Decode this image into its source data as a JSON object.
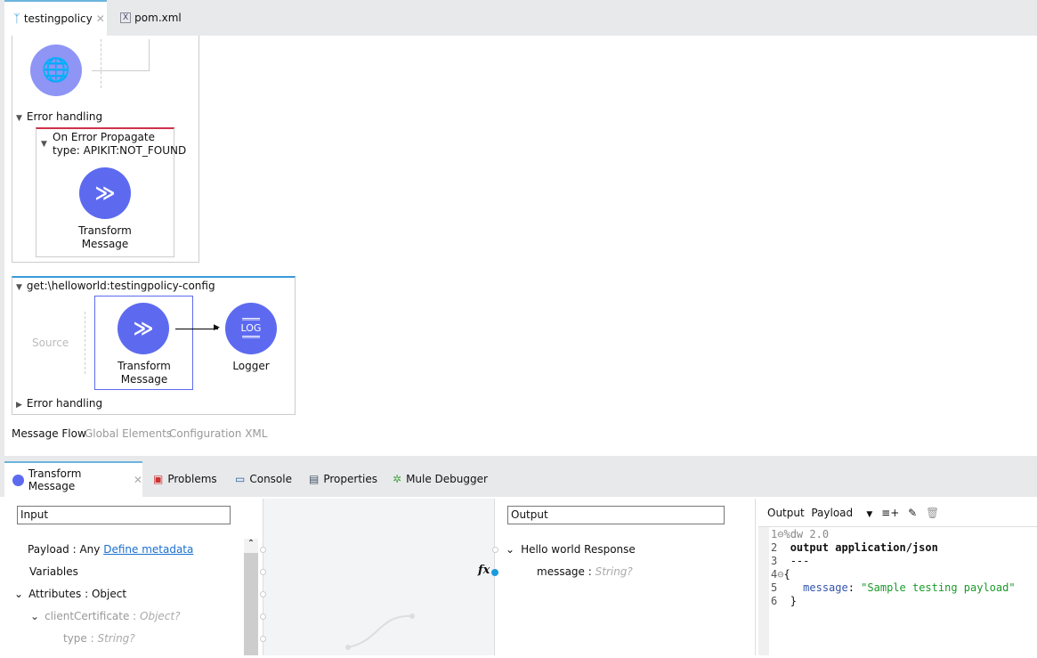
{
  "editor_tabs": [
    {
      "label": "testingpolicy",
      "icon": "mule-icon"
    },
    {
      "label": "pom.xml",
      "icon": "xml-file-icon"
    }
  ],
  "flow1": {
    "error_handling": "Error handling",
    "on_error_title": "On Error Propagate",
    "on_error_type": "type: APIKIT:NOT_FOUND",
    "transform": "Transform Message"
  },
  "flow2": {
    "name": "get:\\helloworld:testingpolicy-config",
    "source": "Source",
    "transform": "Transform Message",
    "logger": "Logger",
    "logger_glyph": "LOG",
    "error_handling": "Error handling"
  },
  "canvas_tabs": [
    "Message Flow",
    "Global Elements",
    "Configuration XML"
  ],
  "bottom_tabs": [
    "Transform Message",
    "Problems",
    "Console",
    "Properties",
    "Mule Debugger"
  ],
  "input": {
    "placeholder": "Input",
    "payload": "Payload : Any",
    "define_metadata": "Define metadata",
    "variables": "Variables",
    "attributes": "Attributes : Object",
    "client_cert": "clientCertificate : ",
    "client_cert_type": "Object?",
    "type": "type : ",
    "type_type": "String?"
  },
  "output": {
    "placeholder": "Output",
    "root": "Hello world Response",
    "field": "message : ",
    "field_type": "String?",
    "fx": "fx"
  },
  "editor": {
    "output_label": "Output",
    "target": "Payload",
    "lines": [
      {
        "n": "1",
        "t": "%dw 2.0"
      },
      {
        "n": "2",
        "t": "output application/json"
      },
      {
        "n": "3",
        "t": "---"
      },
      {
        "n": "4",
        "t": "{"
      },
      {
        "n": "5",
        "k": "message",
        "s": "\"Sample testing payload\""
      },
      {
        "n": "6",
        "t": "}"
      }
    ]
  }
}
